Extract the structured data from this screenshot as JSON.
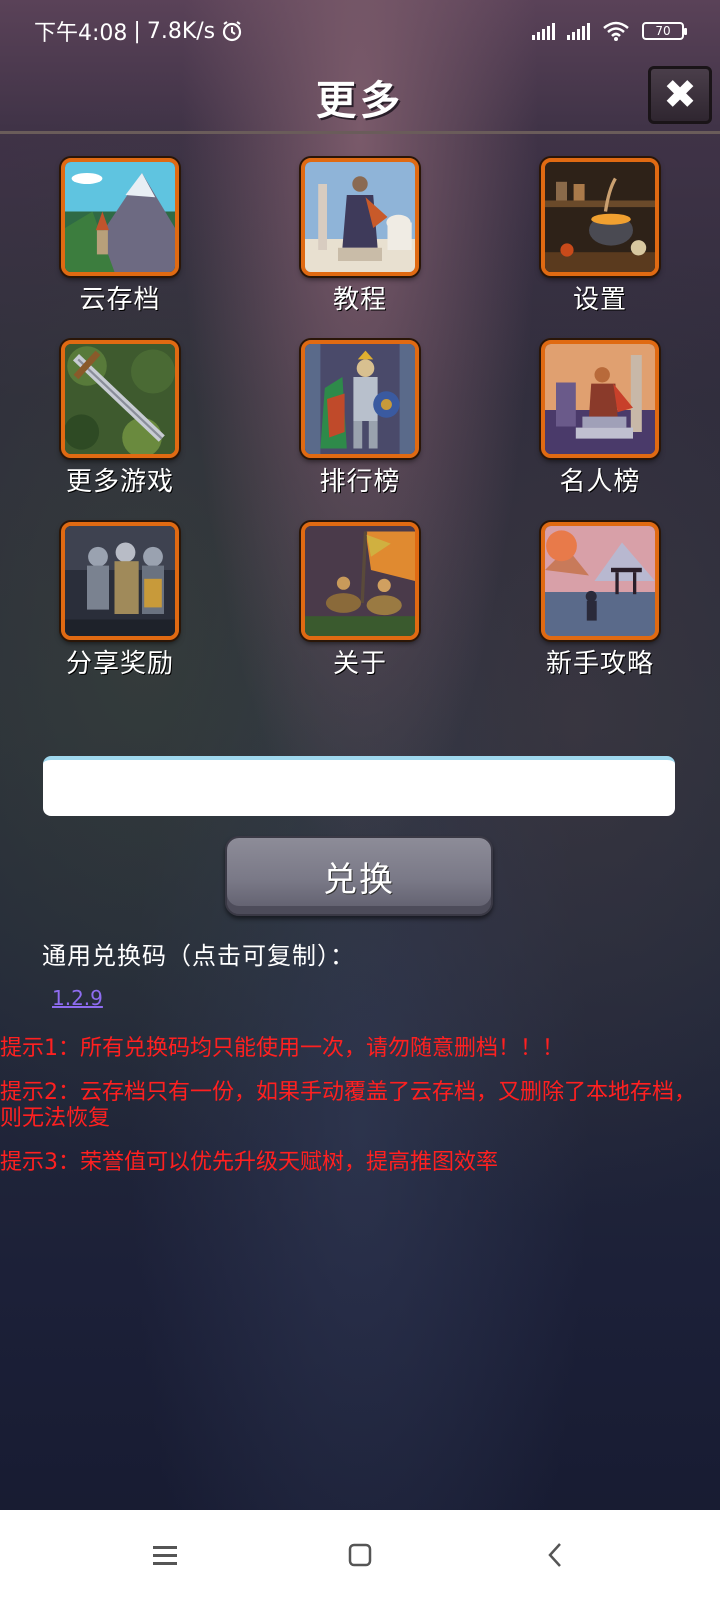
{
  "status": {
    "time": "下午4:08",
    "speed": "7.8K/s",
    "battery": "70"
  },
  "header": {
    "title": "更多",
    "close_label": "✖"
  },
  "menu": [
    {
      "label": "云存档",
      "icon": "cloud-save-mountain-tile"
    },
    {
      "label": "教程",
      "icon": "tutorial-statue-tile"
    },
    {
      "label": "设置",
      "icon": "settings-cauldron-tile"
    },
    {
      "label": "更多游戏",
      "icon": "more-games-sword-tile"
    },
    {
      "label": "排行榜",
      "icon": "leaderboard-knight-tile"
    },
    {
      "label": "名人榜",
      "icon": "hall-of-fame-warrior-tile"
    },
    {
      "label": "分享奖励",
      "icon": "share-reward-knights-tile"
    },
    {
      "label": "关于",
      "icon": "about-riders-tile"
    },
    {
      "label": "新手攻略",
      "icon": "beginner-guide-shrine-tile"
    }
  ],
  "redeem": {
    "input_value": "",
    "button_label": "兑换"
  },
  "codes": {
    "heading": "通用兑换码（点击可复制）：",
    "items": [
      "1.2.9"
    ]
  },
  "tips": [
    "提示1：所有兑换码均只能使用一次，请勿随意删档！！！",
    "提示2：云存档只有一份，如果手动覆盖了云存档，又删除了本地存档，则无法恢复",
    "提示3：荣誉值可以优先升级天赋树，提高推图效率"
  ],
  "colors": {
    "tile_border": "#e06a12",
    "tip_text": "#ff2020",
    "code_link": "#8e6cf0"
  }
}
